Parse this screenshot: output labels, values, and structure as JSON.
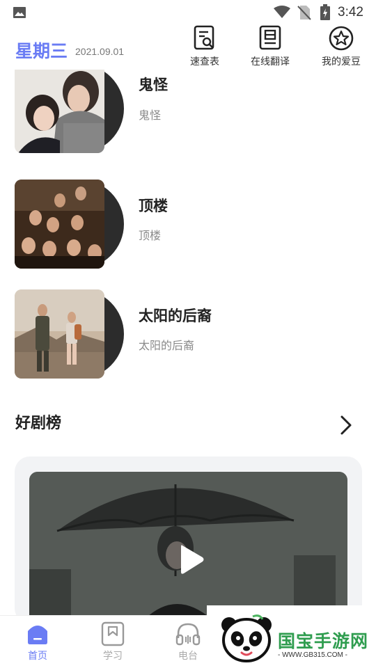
{
  "status_bar": {
    "time": "3:42"
  },
  "header": {
    "weekday": "星期三",
    "date": "2021.09.01",
    "quick_actions": [
      {
        "label": "速查表",
        "icon": "search-document-icon"
      },
      {
        "label": "在线翻译",
        "icon": "translate-document-icon"
      },
      {
        "label": "我的爱豆",
        "icon": "star-circle-icon"
      }
    ]
  },
  "list": {
    "items": [
      {
        "title": "鬼怪",
        "subtitle": "鬼怪"
      },
      {
        "title": "顶楼",
        "subtitle": "顶楼"
      },
      {
        "title": "太阳的后裔",
        "subtitle": "太阳的后裔"
      }
    ]
  },
  "section": {
    "title": "好剧榜"
  },
  "bottom_nav": {
    "items": [
      {
        "label": "首页",
        "icon": "home-icon",
        "active": true
      },
      {
        "label": "学习",
        "icon": "bookmark-icon",
        "active": false
      },
      {
        "label": "电台",
        "icon": "headphones-icon",
        "active": false
      }
    ]
  },
  "watermark": {
    "text": "国宝手游网",
    "url": "- WWW.GB315.COM -"
  },
  "colors": {
    "accent": "#6a7cf4",
    "watermark_green": "#2f9d4f",
    "disc": "#2c2c2c"
  }
}
